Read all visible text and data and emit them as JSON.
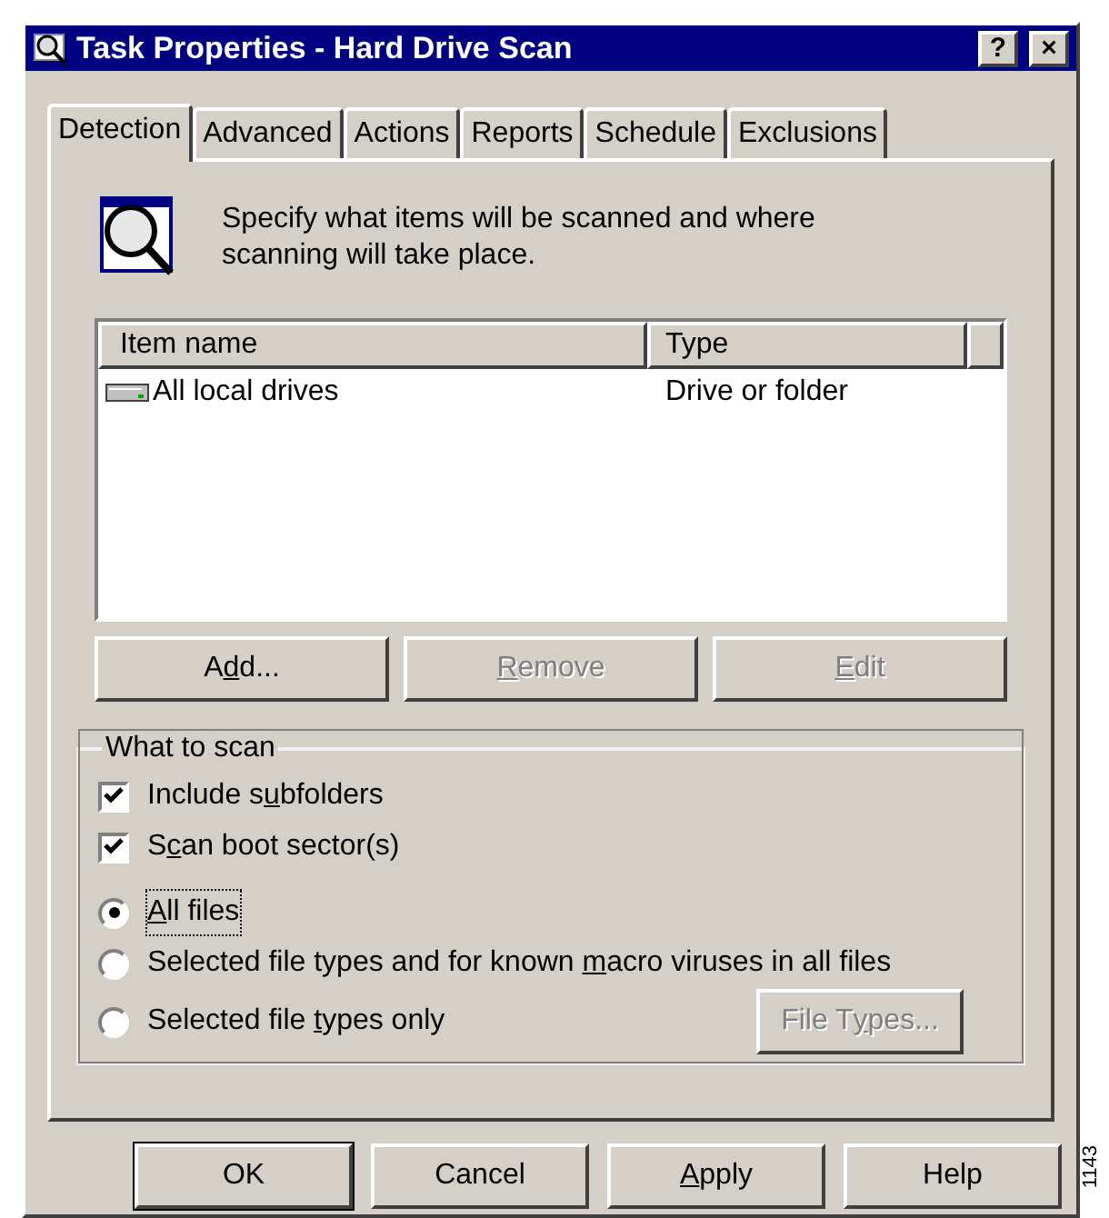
{
  "window": {
    "title": "Task Properties - Hard Drive Scan",
    "title_buttons": [
      "?",
      "×"
    ]
  },
  "tabs": [
    {
      "label": "Detection",
      "selected": true
    },
    {
      "label": "Advanced",
      "selected": false
    },
    {
      "label": "Actions",
      "selected": false
    },
    {
      "label": "Reports",
      "selected": false
    },
    {
      "label": "Schedule",
      "selected": false
    },
    {
      "label": "Exclusions",
      "selected": false
    }
  ],
  "description": "Specify what items will be scanned and where scanning will take place.",
  "list": {
    "columns": [
      "Item name",
      "Type"
    ],
    "rows": [
      {
        "item_name": "All local drives",
        "type": "Drive or folder"
      }
    ]
  },
  "list_buttons": [
    {
      "label_parts": [
        {
          "text": "A",
          "underlined": false
        },
        {
          "text": "d",
          "underlined": true
        },
        {
          "text": "d...",
          "underlined": false
        }
      ],
      "disabled": false
    },
    {
      "label_parts": [
        {
          "text": "R",
          "underlined": true
        },
        {
          "text": "emove",
          "underlined": false
        }
      ],
      "disabled": true
    },
    {
      "label_parts": [
        {
          "text": "E",
          "underlined": true
        },
        {
          "text": "dit",
          "underlined": false
        }
      ],
      "disabled": true
    }
  ],
  "group": {
    "title": "What to scan",
    "options": [
      {
        "kind": "checkbox",
        "label_parts": [
          {
            "text": "Include s",
            "underlined": false
          },
          {
            "text": "u",
            "underlined": true
          },
          {
            "text": "bfolders",
            "underlined": false
          }
        ],
        "checked": true
      },
      {
        "kind": "checkbox",
        "label_parts": [
          {
            "text": "S",
            "underlined": false
          },
          {
            "text": "c",
            "underlined": true
          },
          {
            "text": "an boot sector(s)",
            "underlined": false
          }
        ],
        "checked": true
      },
      {
        "kind": "radio",
        "label_parts": [
          {
            "text": "A",
            "underlined": true
          },
          {
            "text": "ll files",
            "underlined": false
          }
        ],
        "selected": true,
        "focused": true
      },
      {
        "kind": "radio",
        "label_parts": [
          {
            "text": "Selected file types and for known ",
            "underlined": false
          },
          {
            "text": "m",
            "underlined": true
          },
          {
            "text": "acro viruses in all files",
            "underlined": false
          }
        ],
        "selected": false,
        "focused": false
      },
      {
        "kind": "radio",
        "label_parts": [
          {
            "text": "Selected file ",
            "underlined": false
          },
          {
            "text": "t",
            "underlined": true
          },
          {
            "text": "ypes only",
            "underlined": false
          }
        ],
        "selected": false,
        "focused": false
      }
    ],
    "file_types_button": {
      "label_parts": [
        {
          "text": "File T",
          "underlined": false
        },
        {
          "text": "y",
          "underlined": true
        },
        {
          "text": "pes...",
          "underlined": false
        }
      ],
      "disabled": true
    }
  },
  "dialog_buttons": [
    {
      "label_parts": [
        {
          "text": "OK",
          "underlined": false
        }
      ],
      "default": true
    },
    {
      "label_parts": [
        {
          "text": "Cancel",
          "underlined": false
        }
      ],
      "default": false
    },
    {
      "label_parts": [
        {
          "text": "A",
          "underlined": true
        },
        {
          "text": "pply",
          "underlined": false
        }
      ],
      "default": false
    },
    {
      "label_parts": [
        {
          "text": "Help",
          "underlined": false
        }
      ],
      "default": false
    }
  ],
  "figure_number": "1143"
}
